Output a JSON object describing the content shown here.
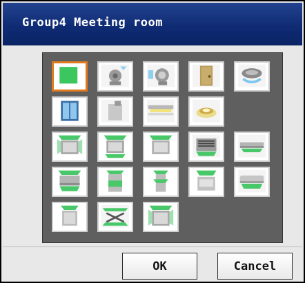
{
  "window": {
    "title": "Group4 Meeting room"
  },
  "icons": [
    "solid-green-square-icon",
    "fan-motor-icon",
    "blower-fan-icon",
    "door-icon",
    "ceiling-diffuser-icon",
    "window-icon",
    "box-unit-icon",
    "fluorescent-light-icon",
    "round-ceiling-light-icon",
    "cassette-4way-icon",
    "cassette-2way-icon",
    "cassette-1way-icon",
    "duct-grille-icon",
    "wall-slim-unit-icon",
    "ceiling-suspended-icon",
    "floor-standing-icon",
    "floor-tower-icon",
    "floor-console-icon",
    "wall-mounted-icon",
    "floor-concealed-icon",
    "heat-exchanger-icon",
    "cassette-4way-small-icon"
  ],
  "buttons": {
    "ok": "OK",
    "cancel": "Cancel"
  },
  "colors": {
    "title_bar": "#0f2b74",
    "selection": "#e07a1e",
    "accent_green": "#39c45c",
    "panel": "#5f5f5f"
  }
}
